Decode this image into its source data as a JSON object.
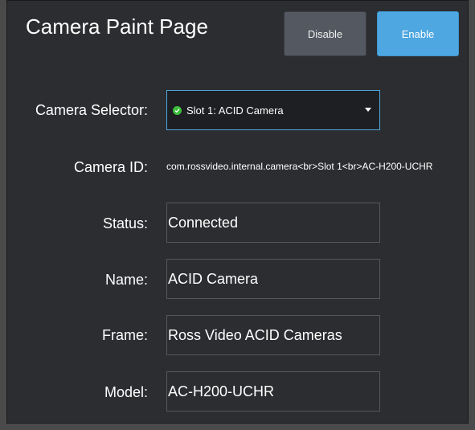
{
  "page": {
    "title": "Camera Paint Page"
  },
  "buttons": {
    "disable": "Disable",
    "enable": "Enable"
  },
  "form": {
    "camera_selector": {
      "label": "Camera Selector:",
      "value": "Slot 1: ACID Camera",
      "status_color": "#3cbe3c"
    },
    "camera_id": {
      "label": "Camera ID:",
      "value": "com.rossvideo.internal.camera<br>Slot 1<br>AC-H200-UCHR"
    },
    "status": {
      "label": "Status:",
      "value": "Connected"
    },
    "name": {
      "label": "Name:",
      "value": "ACID Camera"
    },
    "frame": {
      "label": "Frame:",
      "value": "Ross Video ACID Cameras"
    },
    "model": {
      "label": "Model:",
      "value": "AC-H200-UCHR"
    }
  },
  "colors": {
    "accent": "#4ea7e0",
    "panel": "#2c2d30",
    "status_ok": "#3cbe3c"
  }
}
